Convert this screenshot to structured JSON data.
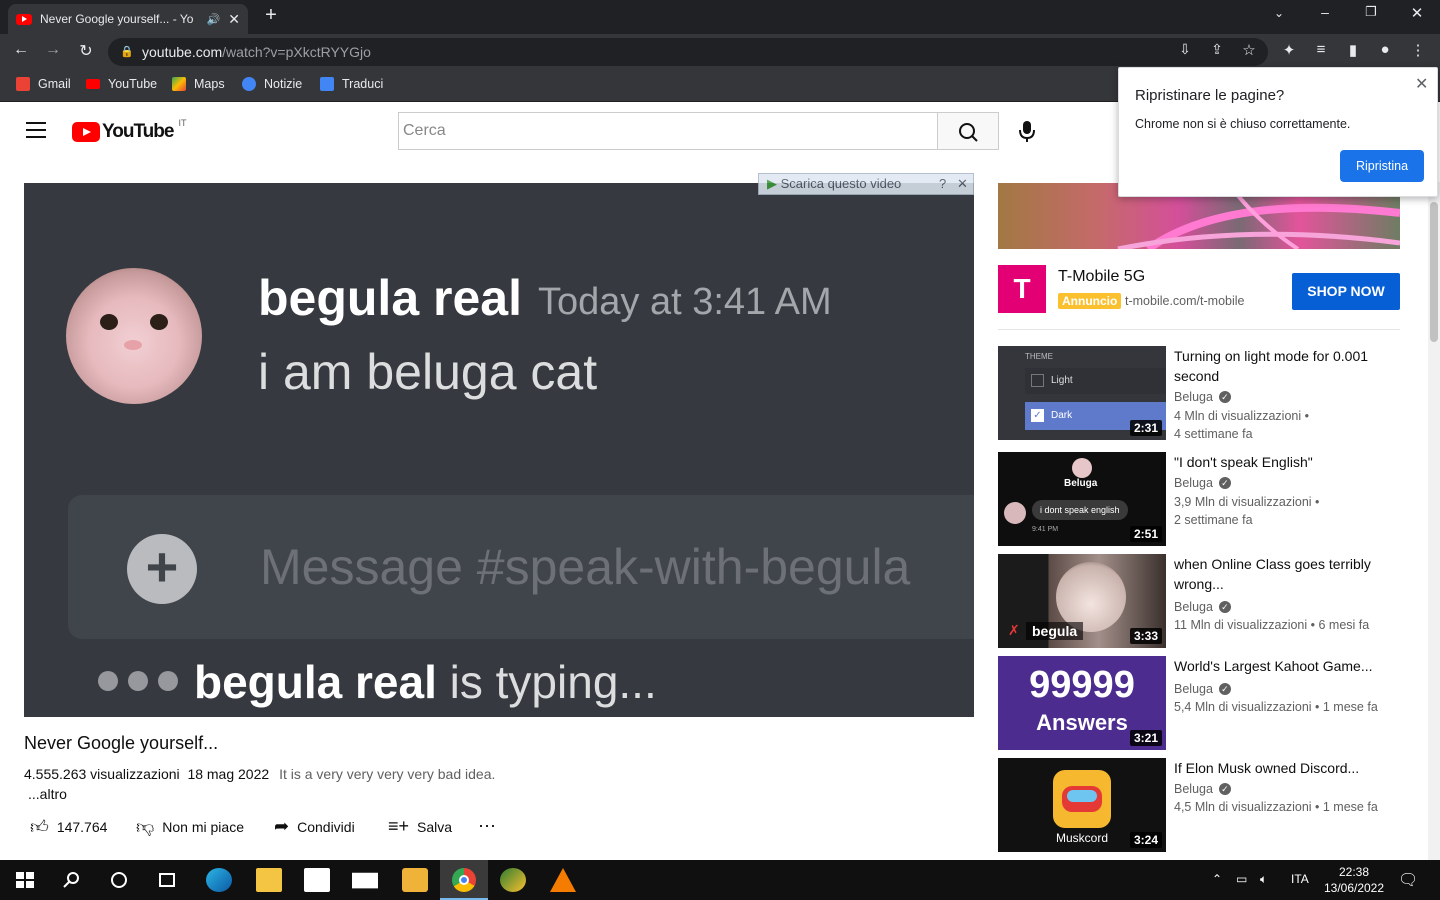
{
  "browser": {
    "tab_title": "Never Google yourself... - Yo",
    "url_host": "youtube.com",
    "url_path": "/watch?v=pXkctRYYGjo",
    "bookmarks": [
      "Gmail",
      "YouTube",
      "Maps",
      "Notizie",
      "Traduci"
    ]
  },
  "restore_dialog": {
    "title": "Ripristinare le pagine?",
    "message": "Chrome non si è chiuso correttamente.",
    "button": "Ripristina"
  },
  "youtube": {
    "logo_text": "YouTube",
    "country_code": "IT",
    "search_placeholder": "Cerca"
  },
  "player": {
    "author": "begula real",
    "timestamp": "Today at 3:41 AM",
    "message": "i am beluga cat",
    "input_placeholder": "Message #speak-with-begula",
    "typing_name": "begula real",
    "typing_suffix": " is typing...",
    "download_overlay": "Scarica questo video"
  },
  "video": {
    "title": "Never Google yourself...",
    "views": "4.555.263 visualizzazioni",
    "date": "18 mag 2022",
    "description": "It is a very very very very bad idea.",
    "more": "...altro",
    "likes": "147.764",
    "dislike_label": "Non mi piace",
    "share_label": "Condividi",
    "save_label": "Salva"
  },
  "ad": {
    "title": "T-Mobile 5G",
    "badge": "Annuncio",
    "url": "t-mobile.com/t-mobile",
    "cta": "SHOP NOW"
  },
  "recommendations": [
    {
      "title": "Turning on light mode for 0.001 second",
      "channel": "Beluga",
      "views": "4 Mln di visualizzazioni •",
      "age": "4 settimane fa",
      "duration": "2:31",
      "thumb_text": [
        "THEME",
        "Light",
        "Dark"
      ]
    },
    {
      "title": "\"I don't speak English\"",
      "channel": "Beluga",
      "views": "3,9 Mln di visualizzazioni •",
      "age": "2 settimane fa",
      "duration": "2:51",
      "thumb_text": [
        "Beluga",
        "i dont speak english",
        "9:41 PM"
      ]
    },
    {
      "title": "when Online Class goes terribly wrong...",
      "channel": "Beluga",
      "views": "11 Mln di visualizzazioni • 6 mesi fa",
      "age": "",
      "duration": "3:33",
      "thumb_text": [
        "begula"
      ]
    },
    {
      "title": "World's Largest Kahoot Game...",
      "channel": "Beluga",
      "views": "5,4 Mln di visualizzazioni • 1 mese fa",
      "age": "",
      "duration": "3:21",
      "thumb_text": [
        "99999",
        "Answers"
      ]
    },
    {
      "title": "If Elon Musk owned Discord...",
      "channel": "Beluga",
      "views": "4,5 Mln di visualizzazioni • 1 mese fa",
      "age": "",
      "duration": "3:24",
      "thumb_text": [
        "Muskcord"
      ]
    }
  ],
  "taskbar": {
    "language": "ITA",
    "time": "22:38",
    "date": "13/06/2022"
  },
  "colors": {
    "youtube_red": "#ff0000",
    "tmobile_magenta": "#e20074",
    "shop_blue": "#065fd4",
    "discord_bg": "#36393f"
  }
}
